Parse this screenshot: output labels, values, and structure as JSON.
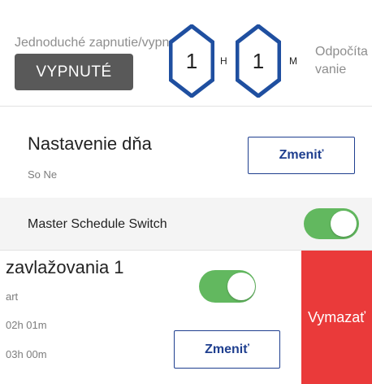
{
  "top": {
    "simple_label": "Jednoduché zapnutie/vypnutie",
    "off_button": "VYPNUTÉ",
    "hours_value": "1",
    "hours_unit": "H",
    "minutes_value": "1",
    "minutes_unit": "M",
    "countdown_line1": "Odpočíta",
    "countdown_line2": "vanie"
  },
  "day_setting": {
    "title": "Nastavenie dňa",
    "days": "So Ne",
    "edit_label": "Zmeniť"
  },
  "master": {
    "label": "Master Schedule Switch",
    "enabled": true
  },
  "schedule_item": {
    "title": "zavlažovania 1",
    "line1": "art",
    "line2": "02h 01m",
    "line3": "03h 00m",
    "enabled": true,
    "edit_label": "Zmeniť",
    "delete_label": "Vymazať"
  },
  "colors": {
    "toggle_on": "#62b85f",
    "delete": "#ea3a3a",
    "accent": "#1f3f8f",
    "hex_border": "#1f4fa0",
    "off_button": "#595959"
  }
}
